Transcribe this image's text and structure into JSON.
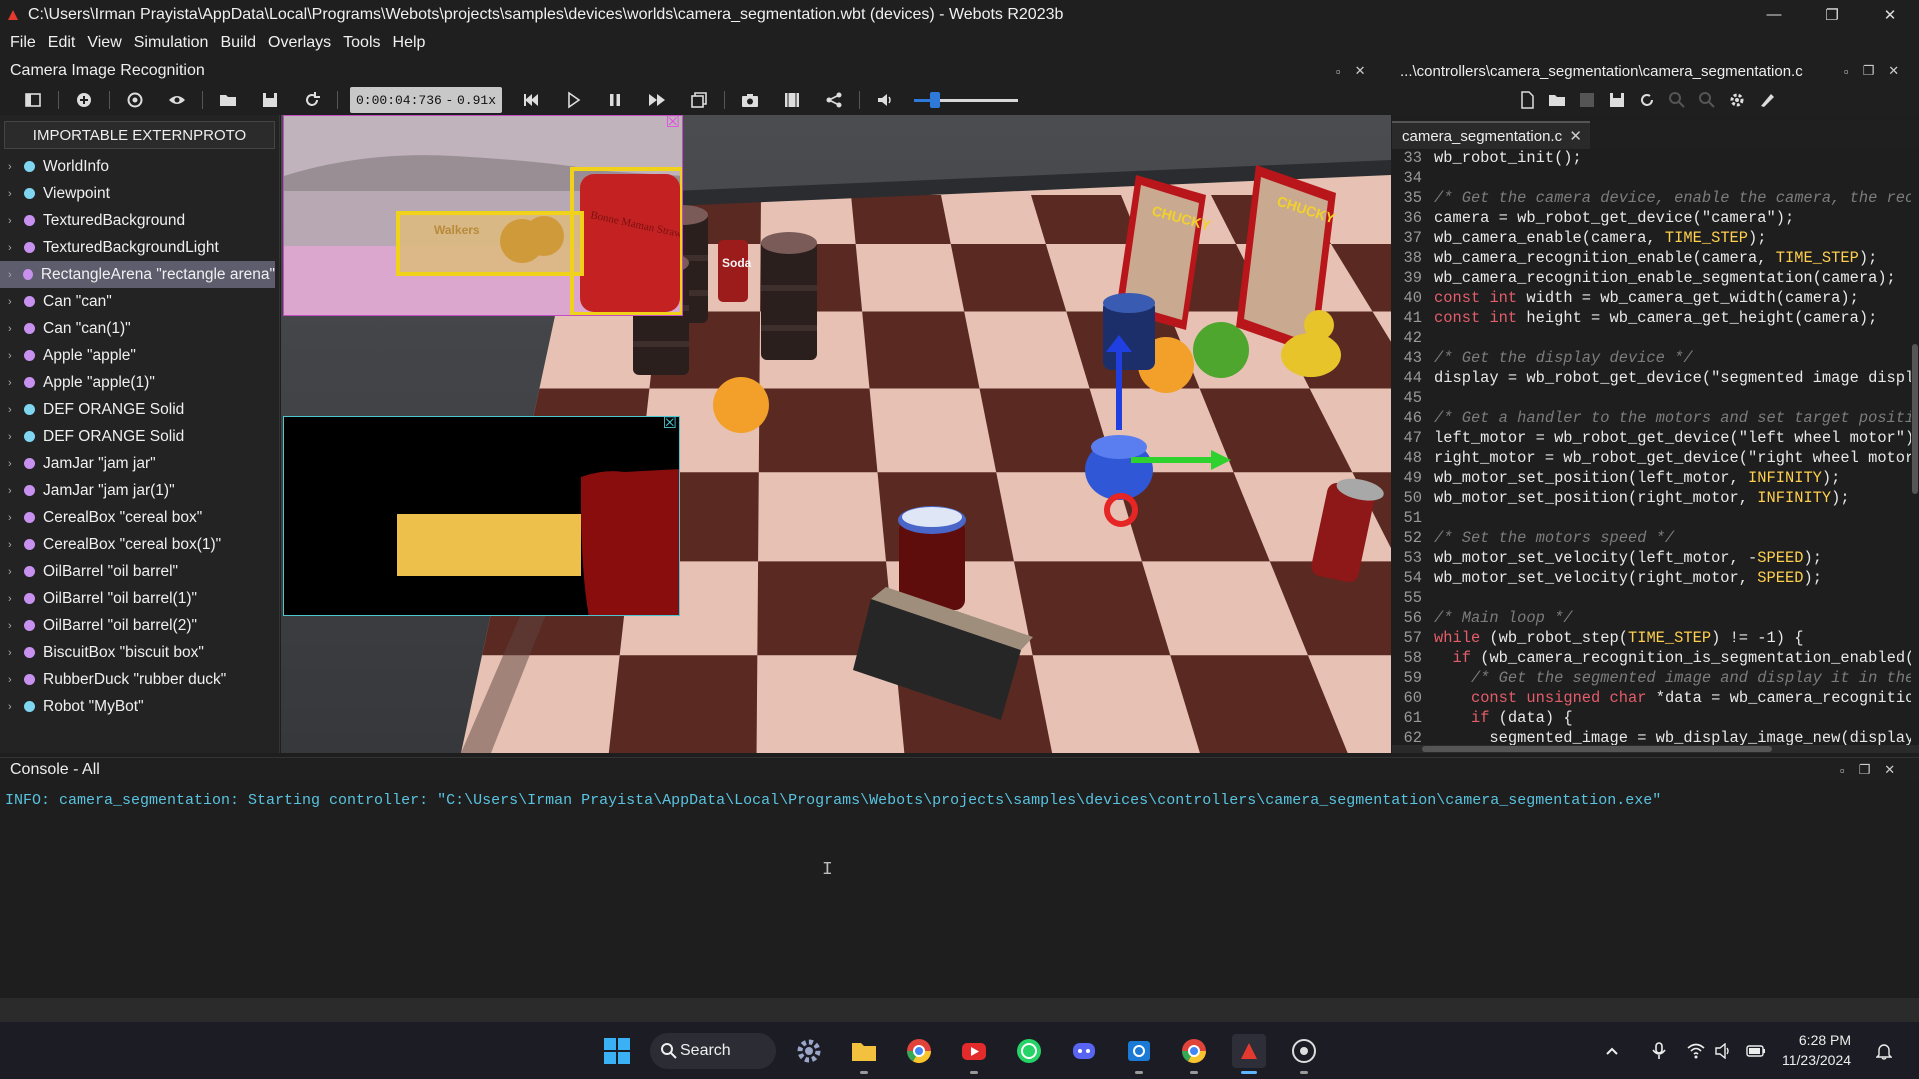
{
  "window": {
    "title": "C:\\Users\\Irman Prayista\\AppData\\Local\\Programs\\Webots\\projects\\samples\\devices\\worlds\\camera_segmentation.wbt (devices) - Webots R2023b",
    "minimize": "—",
    "maximize": "❐",
    "close": "✕"
  },
  "menu": [
    "File",
    "Edit",
    "View",
    "Simulation",
    "Build",
    "Overlays",
    "Tools",
    "Help"
  ],
  "left_dock": {
    "title": "Camera Image Recognition"
  },
  "toolbar": {
    "time": "0:00:04:736",
    "dash": "-",
    "speed": "0.91x",
    "volume_level": 0.2
  },
  "scene_tree": {
    "proto_button": "IMPORTABLE EXTERNPROTO",
    "items": [
      {
        "label": "WorldInfo",
        "color": "#7fd6f0"
      },
      {
        "label": "Viewpoint",
        "color": "#7fd6f0"
      },
      {
        "label": "TexturedBackground",
        "color": "#c891f0"
      },
      {
        "label": "TexturedBackgroundLight",
        "color": "#c891f0"
      },
      {
        "label": "RectangleArena \"rectangle arena\"",
        "color": "#c891f0"
      },
      {
        "label": "Can \"can\"",
        "color": "#c891f0"
      },
      {
        "label": "Can \"can(1)\"",
        "color": "#c891f0"
      },
      {
        "label": "Apple \"apple\"",
        "color": "#c891f0"
      },
      {
        "label": "Apple \"apple(1)\"",
        "color": "#c891f0"
      },
      {
        "label": "DEF ORANGE Solid",
        "color": "#7fd6f0"
      },
      {
        "label": "DEF ORANGE Solid",
        "color": "#7fd6f0"
      },
      {
        "label": "JamJar \"jam jar\"",
        "color": "#c891f0"
      },
      {
        "label": "JamJar \"jam jar(1)\"",
        "color": "#c891f0"
      },
      {
        "label": "CerealBox \"cereal box\"",
        "color": "#c891f0"
      },
      {
        "label": "CerealBox \"cereal box(1)\"",
        "color": "#c891f0"
      },
      {
        "label": "OilBarrel \"oil barrel\"",
        "color": "#c891f0"
      },
      {
        "label": "OilBarrel \"oil barrel(1)\"",
        "color": "#c891f0"
      },
      {
        "label": "OilBarrel \"oil barrel(2)\"",
        "color": "#c891f0"
      },
      {
        "label": "BiscuitBox \"biscuit box\"",
        "color": "#c891f0"
      },
      {
        "label": "RubberDuck \"rubber duck\"",
        "color": "#c891f0"
      },
      {
        "label": "Robot \"MyBot\"",
        "color": "#7fd6f0"
      }
    ],
    "selected_index": 4
  },
  "view3d": {
    "overlay_close": "☒",
    "biscuit_text": "Walkers",
    "jam_label": "Bonne Maman Strawberry Preserve",
    "can_label": "Soda",
    "cereal_label": "CHUCKY",
    "cereal_badge": "CHUCKY"
  },
  "editor": {
    "title": "...\\controllers\\camera_segmentation\\camera_segmentation.c",
    "tab": "camera_segmentation.c",
    "tab_close": "✕",
    "lines": [
      {
        "n": "33",
        "c": "wb_robot_init();"
      },
      {
        "n": "34",
        "c": ""
      },
      {
        "n": "35",
        "c": "/* Get the camera device, enable the camera, the reco"
      },
      {
        "n": "36",
        "c": "camera = wb_robot_get_device(\"camera\");"
      },
      {
        "n": "37",
        "c": "wb_camera_enable(camera, TIME_STEP);"
      },
      {
        "n": "38",
        "c": "wb_camera_recognition_enable(camera, TIME_STEP);"
      },
      {
        "n": "39",
        "c": "wb_camera_recognition_enable_segmentation(camera);"
      },
      {
        "n": "40",
        "c": "const int width = wb_camera_get_width(camera);"
      },
      {
        "n": "41",
        "c": "const int height = wb_camera_get_height(camera);"
      },
      {
        "n": "42",
        "c": ""
      },
      {
        "n": "43",
        "c": "/* Get the display device */"
      },
      {
        "n": "44",
        "c": "display = wb_robot_get_device(\"segmented image displa"
      },
      {
        "n": "45",
        "c": ""
      },
      {
        "n": "46",
        "c": "/* Get a handler to the motors and set target positi"
      },
      {
        "n": "47",
        "c": "left_motor = wb_robot_get_device(\"left wheel motor\");"
      },
      {
        "n": "48",
        "c": "right_motor = wb_robot_get_device(\"right wheel motor\""
      },
      {
        "n": "49",
        "c": "wb_motor_set_position(left_motor, INFINITY);"
      },
      {
        "n": "50",
        "c": "wb_motor_set_position(right_motor, INFINITY);"
      },
      {
        "n": "51",
        "c": ""
      },
      {
        "n": "52",
        "c": "/* Set the motors speed */"
      },
      {
        "n": "53",
        "c": "wb_motor_set_velocity(left_motor, -SPEED);"
      },
      {
        "n": "54",
        "c": "wb_motor_set_velocity(right_motor, SPEED);"
      },
      {
        "n": "55",
        "c": ""
      },
      {
        "n": "56",
        "c": "/* Main loop */"
      },
      {
        "n": "57",
        "c": "while (wb_robot_step(TIME_STEP) != -1) {"
      },
      {
        "n": "58",
        "c": "  if (wb_camera_recognition_is_segmentation_enabled(c"
      },
      {
        "n": "59",
        "c": "    /* Get the segmented image and display it in the"
      },
      {
        "n": "60",
        "c": "    const unsigned char *data = wb_camera_recognition"
      },
      {
        "n": "61",
        "c": "    if (data) {"
      },
      {
        "n": "62",
        "c": "      segmented_image = wb_display_image_new(display,"
      }
    ]
  },
  "console": {
    "title": "Console - All",
    "message": "INFO: camera_segmentation: Starting controller: \"C:\\Users\\Irman Prayista\\AppData\\Local\\Programs\\Webots\\projects\\samples\\devices\\controllers\\camera_segmentation\\camera_segmentation.exe\""
  },
  "taskbar": {
    "search": "Search",
    "time": "6:28 PM",
    "date": "11/23/2024"
  }
}
